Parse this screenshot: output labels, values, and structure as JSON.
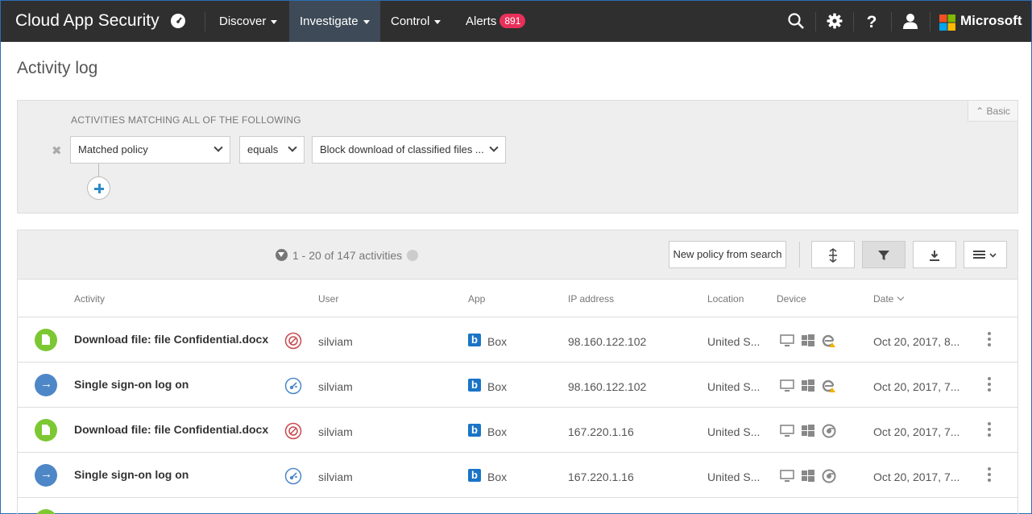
{
  "app": {
    "title": "Cloud App Security",
    "brand": "Microsoft"
  },
  "nav": {
    "items": [
      {
        "label": "Discover"
      },
      {
        "label": "Investigate"
      },
      {
        "label": "Control"
      },
      {
        "label": "Alerts",
        "badge": "891"
      }
    ]
  },
  "page": {
    "title": "Activity log"
  },
  "filter": {
    "heading": "ACTIVITIES MATCHING ALL OF THE FOLLOWING",
    "basic_label": "Basic",
    "field": "Matched policy",
    "operator": "equals",
    "value": "Block download of classified files ..."
  },
  "results": {
    "count_label": "1 - 20 of 147 activities",
    "new_policy_label": "New policy from search",
    "columns": {
      "activity": "Activity",
      "user": "User",
      "app": "App",
      "ip": "IP address",
      "location": "Location",
      "device": "Device",
      "date": "Date"
    },
    "rows": [
      {
        "activity": "Download file: file Confidential.docx",
        "type": "download",
        "policy_icon": "block-icon",
        "user": "silviam",
        "app": "Box",
        "ip": "98.160.122.102",
        "location": "United S...",
        "browser": "edge-warning",
        "date": "Oct 20, 2017, 8..."
      },
      {
        "activity": "Single sign-on log on",
        "type": "logon",
        "policy_icon": "session-icon",
        "user": "silviam",
        "app": "Box",
        "ip": "98.160.122.102",
        "location": "United S...",
        "browser": "edge-warning",
        "date": "Oct 20, 2017, 7..."
      },
      {
        "activity": "Download file: file Confidential.docx",
        "type": "download",
        "policy_icon": "block-icon",
        "user": "silviam",
        "app": "Box",
        "ip": "167.220.1.16",
        "location": "United S...",
        "browser": "chrome",
        "date": "Oct 20, 2017, 7..."
      },
      {
        "activity": "Single sign-on log on",
        "type": "logon",
        "policy_icon": "session-icon",
        "user": "silviam",
        "app": "Box",
        "ip": "167.220.1.16",
        "location": "United S...",
        "browser": "chrome",
        "date": "Oct 20, 2017, 7..."
      }
    ]
  },
  "colors": {
    "nav_bg": "#2f2f2f",
    "active_nav": "#3e4a57",
    "badge": "#e8305a",
    "green": "#7cc832",
    "blue": "#4d87c7",
    "block_red": "#c9474d",
    "box_blue": "#1a74c6"
  }
}
